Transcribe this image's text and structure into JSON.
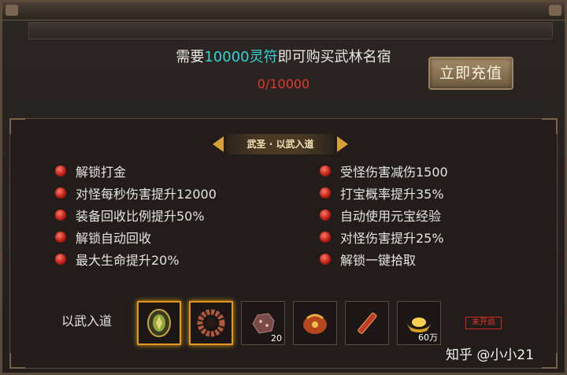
{
  "header": {
    "prefix": "需要",
    "amount": "10000灵符",
    "suffix": "即可购买武林名宿",
    "progress": "0/10000",
    "recharge_label": "立即充值"
  },
  "section": {
    "title": "武圣 · 以武入道"
  },
  "perks_left": [
    "解锁打金",
    "对怪每秒伤害提升12000",
    "装备回收比例提升50%",
    "解锁自动回收",
    "最大生命提升20%"
  ],
  "perks_right": [
    "受怪伤害减伤1500",
    "打宝概率提升35%",
    "自动使用元宝经验",
    "对怪伤害提升25%",
    "解锁一键拾取"
  ],
  "rewards": {
    "label": "以武入道",
    "items": [
      {
        "icon": "jade-token-icon",
        "count": ""
      },
      {
        "icon": "prayer-ring-icon",
        "count": ""
      },
      {
        "icon": "ore-chunk-icon",
        "count": "20"
      },
      {
        "icon": "treasure-pouch-icon",
        "count": ""
      },
      {
        "icon": "scroll-icon",
        "count": ""
      },
      {
        "icon": "gold-ingot-icon",
        "count": "60万"
      }
    ],
    "status": "未开启"
  },
  "watermark": "知乎 @小小21",
  "colors": {
    "accent_cyan": "#35d3d6",
    "accent_red": "#e23a2a",
    "frame_gold": "#e09a1f"
  }
}
